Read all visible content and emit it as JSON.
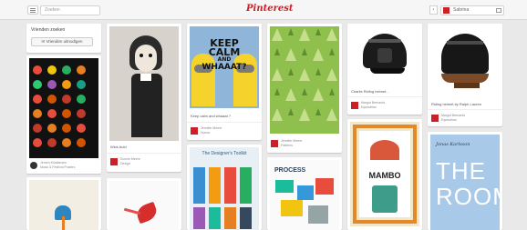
{
  "header": {
    "search_placeholder": "Zoeken",
    "logo": "Pinterest",
    "user_name": "Sabrina"
  },
  "pins": {
    "friends_title": "Vrienden zoeken",
    "friends_button": "Vrienden uitnodigen",
    "dots_meta_name": "Jeroen Kristiansen",
    "dots_meta_sub": "Music & Festival Posters",
    "wednesday_desc": "Wick Auld",
    "wednesday_meta_name": "Sonnie Meere",
    "wednesday_meta_sub": "Design",
    "minions_line1": "KEEP",
    "minions_line2": "CALM",
    "minions_line3": "AND",
    "minions_line4": "WHAAAT?",
    "minions_desc": "Keep calm and whaaat ?",
    "minions_meta_name": "Jennifer Meere",
    "minions_meta_sub": "Humor",
    "swiss_title": "The Designer's Toolkit",
    "pattern_meta_name": "Jennifer Meere",
    "pattern_meta_sub": "Patterns",
    "process_label": "PROCESS",
    "helmet1_desc": "Charlie Riding helmet...",
    "helmet1_meta_name": "Margot Bernards",
    "helmet1_meta_sub": "Equestrian",
    "mambo_label": "MAMBO",
    "helmet2_desc": "Riding helmet by Ralph Lauren",
    "helmet2_meta_name": "Margot Bernards",
    "helmet2_meta_sub": "Equestrian",
    "room_line1": "THE",
    "room_line2": "ROOM",
    "room_small": "Jonas Karlsson"
  }
}
